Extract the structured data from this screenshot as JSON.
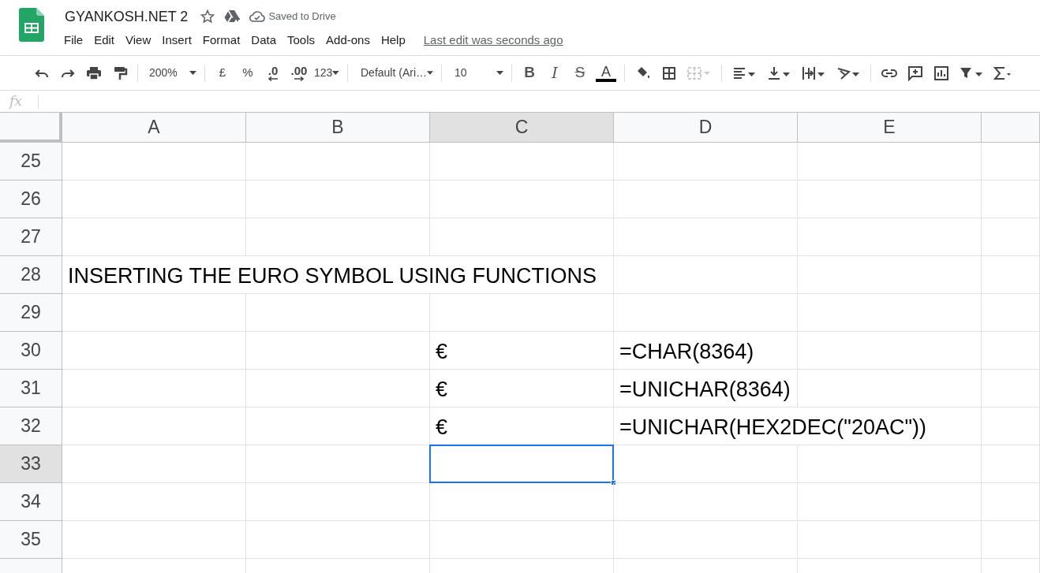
{
  "app": {
    "title": "GYANKOSH.NET 2",
    "save_status": "Saved to Drive"
  },
  "menu": [
    "File",
    "Edit",
    "View",
    "Insert",
    "Format",
    "Data",
    "Tools",
    "Add-ons",
    "Help"
  ],
  "last_edit": "Last edit was seconds ago",
  "toolbar": {
    "zoom": "200%",
    "currency": "£",
    "percent": "%",
    "decrease_decimals": ".0",
    "increase_decimals": ".00",
    "number_format": "123",
    "font": "Default (Ari…",
    "font_size": "10",
    "bold": "B",
    "italic": "I",
    "strikethrough": "S",
    "text_color": "A"
  },
  "formula_bar": {
    "label": "fx"
  },
  "columns": [
    {
      "label": "A",
      "selected": false
    },
    {
      "label": "B",
      "selected": false
    },
    {
      "label": "C",
      "selected": true
    },
    {
      "label": "D",
      "selected": false
    },
    {
      "label": "E",
      "selected": false
    }
  ],
  "rows": [
    {
      "number": "25",
      "selected": false,
      "cells": {}
    },
    {
      "number": "26",
      "selected": false,
      "cells": {}
    },
    {
      "number": "27",
      "selected": false,
      "cells": {}
    },
    {
      "number": "28",
      "selected": false,
      "cells": {
        "A": "INSERTING THE EURO SYMBOL USING FUNCTIONS"
      }
    },
    {
      "number": "29",
      "selected": false,
      "cells": {}
    },
    {
      "number": "30",
      "selected": false,
      "cells": {
        "C": "€",
        "D": "=CHAR(8364)"
      }
    },
    {
      "number": "31",
      "selected": false,
      "cells": {
        "C": "€",
        "D": "=UNICHAR(8364)"
      }
    },
    {
      "number": "32",
      "selected": false,
      "cells": {
        "C": "€",
        "D": "=UNICHAR(HEX2DEC(\"20AC\"))"
      }
    },
    {
      "number": "33",
      "selected": true,
      "cells": {}
    },
    {
      "number": "34",
      "selected": false,
      "cells": {}
    },
    {
      "number": "35",
      "selected": false,
      "cells": {}
    }
  ]
}
